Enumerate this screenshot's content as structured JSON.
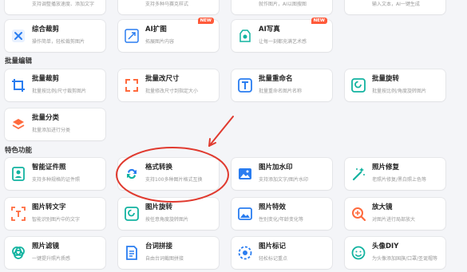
{
  "top_row": [
    {
      "desc": "支持调整播放速度、添加文字"
    },
    {
      "desc": "支持多种马赛克样式"
    },
    {
      "desc": "就作图片，AI以图搜图"
    },
    {
      "desc": "输入文本，AI一键生成"
    }
  ],
  "row_ai": [
    {
      "title": "综合裁剪",
      "desc": "操作简单，轻松裁剪图片"
    },
    {
      "title": "AI扩图",
      "desc": "拓展图片内容",
      "badge": "NEW"
    },
    {
      "title": "AI写真",
      "desc": "让每一刻都充满艺术感",
      "badge": "NEW"
    }
  ],
  "section_batch": "批量编辑",
  "batch": [
    {
      "title": "批量裁剪",
      "desc": "批量按比例/尺寸裁剪图片"
    },
    {
      "title": "批量改尺寸",
      "desc": "批量修改尺寸到指定大小"
    },
    {
      "title": "批量重命名",
      "desc": "批量重命名图片名称"
    },
    {
      "title": "批量旋转",
      "desc": "批量按比例/角度旋转图片"
    },
    {
      "title": "批量分类",
      "desc": "批量添加进行分类"
    }
  ],
  "section_special": "特色功能",
  "special": [
    {
      "title": "智能证件照",
      "desc": "支持多种规格的证件照"
    },
    {
      "title": "格式转换",
      "desc": "支持100多种图片格式互换"
    },
    {
      "title": "图片加水印",
      "desc": "支持添加文字/图片水印"
    },
    {
      "title": "照片修复",
      "desc": "老照片修复/黑白照上色等"
    },
    {
      "title": "图片转文字",
      "desc": "智能识别图片中的文字"
    },
    {
      "title": "图片旋转",
      "desc": "按任意角度旋转图片"
    },
    {
      "title": "照片特效",
      "desc": "性别变化/年龄变化等"
    },
    {
      "title": "放大镜",
      "desc": "对图片进行局部放大"
    },
    {
      "title": "照片滤镜",
      "desc": "一键提升照片质感"
    },
    {
      "title": "台词拼接",
      "desc": "自由台词截图拼接"
    },
    {
      "title": "图片标记",
      "desc": "轻松标记重点"
    },
    {
      "title": "头像DIY",
      "desc": "为头像添加国旗/口罩/圣诞帽等"
    }
  ],
  "colors": {
    "accent": "#2a7df0",
    "annotation": "#e03a2f",
    "badge": "#ff5a3a"
  }
}
